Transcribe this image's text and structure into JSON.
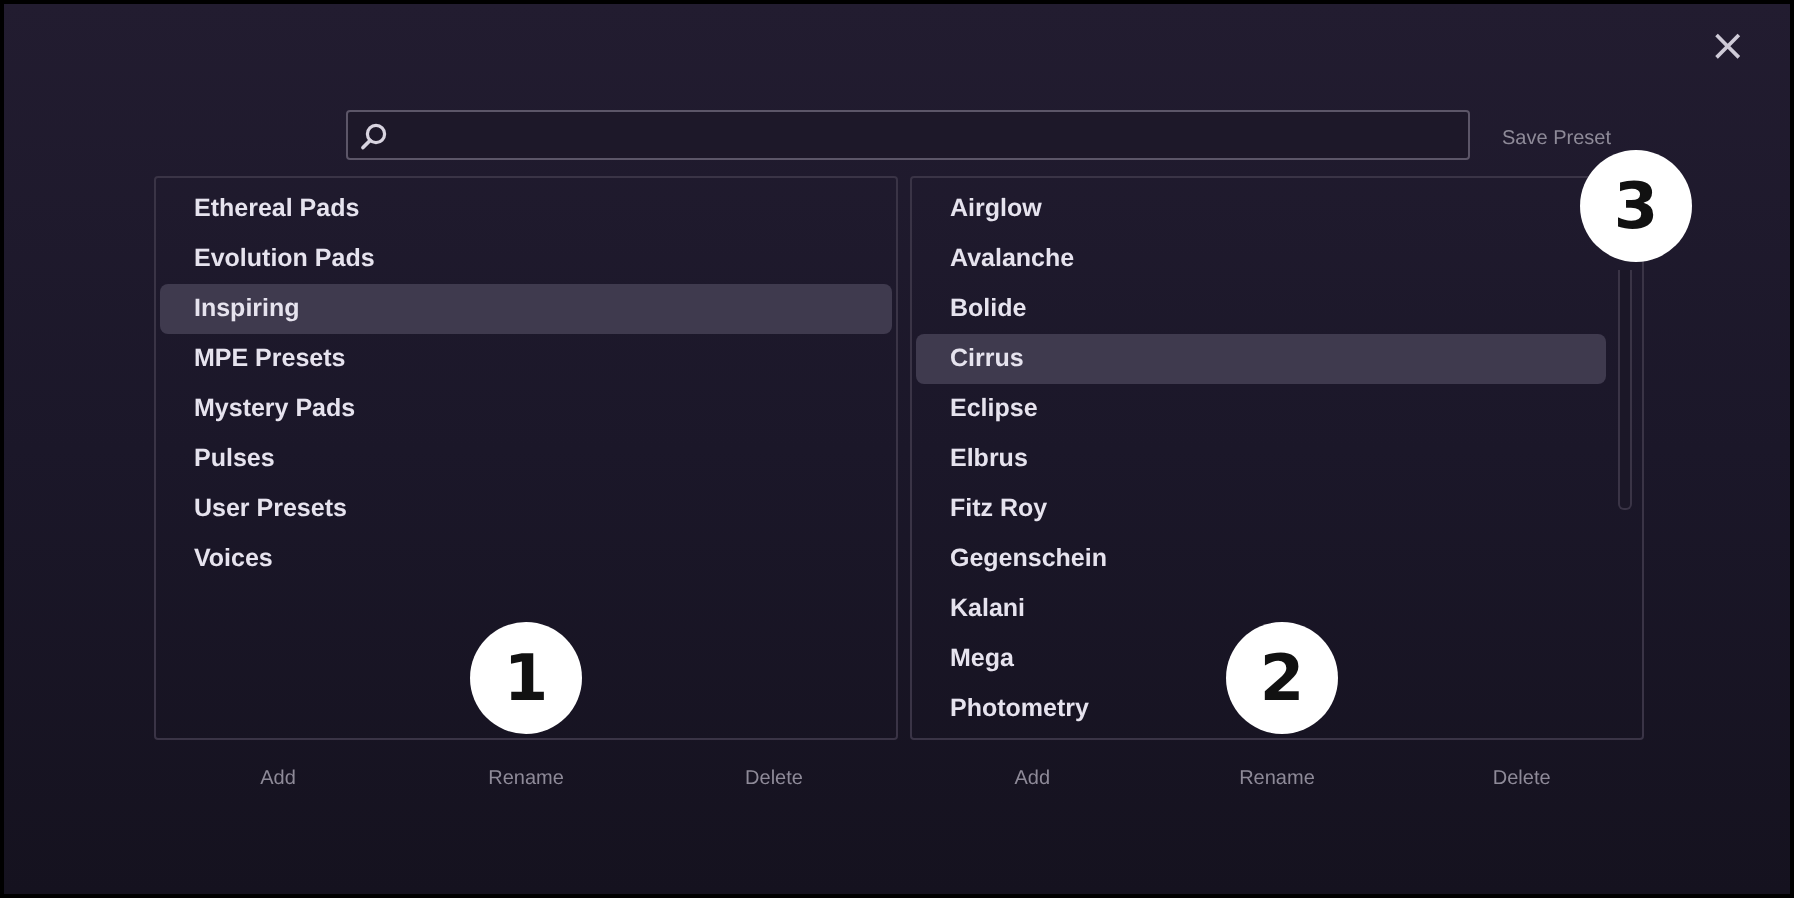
{
  "save_button": "Save Preset",
  "close_button": "×",
  "panels": [
    {
      "items": [
        {
          "label": "Ethereal Pads",
          "selected": false
        },
        {
          "label": "Evolution Pads",
          "selected": false
        },
        {
          "label": "Inspiring",
          "selected": true
        },
        {
          "label": "MPE Presets",
          "selected": false
        },
        {
          "label": "Mystery Pads",
          "selected": false
        },
        {
          "label": "Pulses",
          "selected": false
        },
        {
          "label": "User Presets",
          "selected": false
        },
        {
          "label": "Voices",
          "selected": false
        }
      ],
      "buttons": [
        "Add",
        "Rename",
        "Delete"
      ],
      "callout": "1",
      "scrollbar": false
    },
    {
      "items": [
        {
          "label": "Airglow",
          "selected": false
        },
        {
          "label": "Avalanche",
          "selected": false
        },
        {
          "label": "Bolide",
          "selected": false
        },
        {
          "label": "Cirrus",
          "selected": true
        },
        {
          "label": "Eclipse",
          "selected": false
        },
        {
          "label": "Elbrus",
          "selected": false
        },
        {
          "label": "Fitz Roy",
          "selected": false
        },
        {
          "label": "Gegenschein",
          "selected": false
        },
        {
          "label": "Kalani",
          "selected": false
        },
        {
          "label": "Mega",
          "selected": false
        },
        {
          "label": "Photometry",
          "selected": false
        }
      ],
      "buttons": [
        "Add",
        "Rename",
        "Delete"
      ],
      "callout": "2",
      "scrollbar": true
    }
  ],
  "save_callout": "3"
}
